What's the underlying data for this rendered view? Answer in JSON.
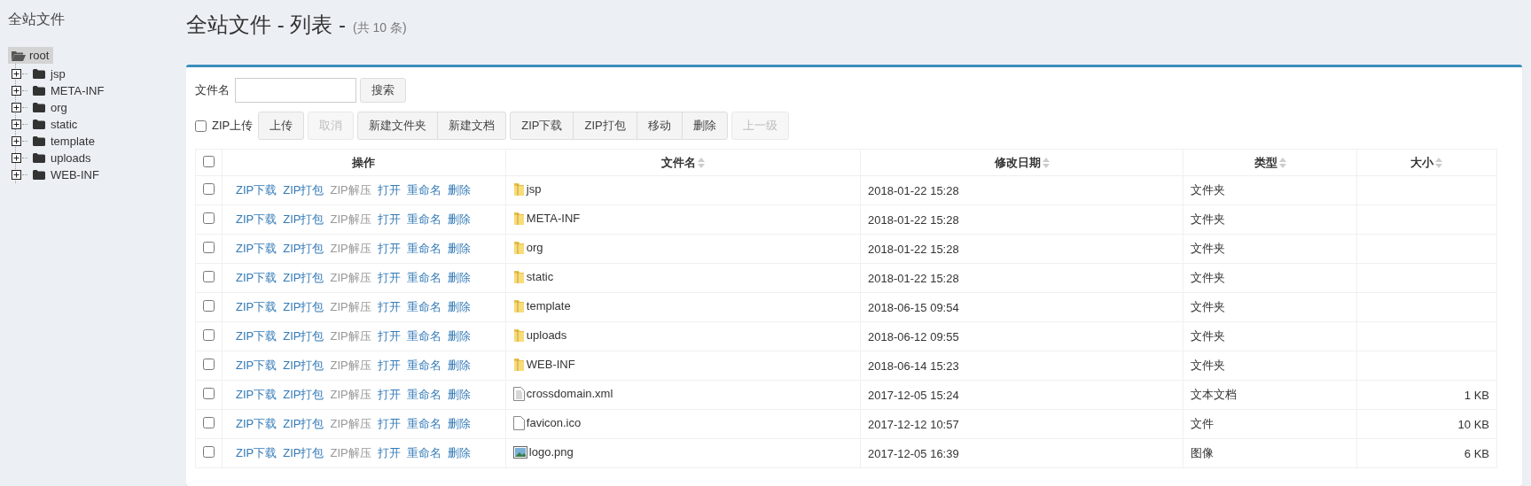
{
  "sidebar": {
    "title": "全站文件",
    "tree": {
      "label": "root",
      "selected": true,
      "expanded": true,
      "children": [
        {
          "label": "jsp",
          "selected": false,
          "expanded": false
        },
        {
          "label": "META-INF",
          "selected": false,
          "expanded": false
        },
        {
          "label": "org",
          "selected": false,
          "expanded": false
        },
        {
          "label": "static",
          "selected": false,
          "expanded": false
        },
        {
          "label": "template",
          "selected": false,
          "expanded": false
        },
        {
          "label": "uploads",
          "selected": false,
          "expanded": false
        },
        {
          "label": "WEB-INF",
          "selected": false,
          "expanded": false
        }
      ]
    }
  },
  "header": {
    "title": "全站文件 - 列表 -",
    "count": "(共 10 条)"
  },
  "search": {
    "label": "文件名",
    "button": "搜索"
  },
  "toolbar": {
    "zip_upload": {
      "label": "ZIP上传",
      "checked": false
    },
    "groups": [
      [
        {
          "label": "上传",
          "disabled": false
        }
      ],
      [
        {
          "label": "取消",
          "disabled": true
        }
      ],
      [
        {
          "label": "新建文件夹",
          "disabled": false
        },
        {
          "label": "新建文档",
          "disabled": false
        }
      ],
      [
        {
          "label": "ZIP下载",
          "disabled": false
        },
        {
          "label": "ZIP打包",
          "disabled": false
        },
        {
          "label": "移动",
          "disabled": false
        },
        {
          "label": "删除",
          "disabled": false
        }
      ],
      [
        {
          "label": "上一级",
          "disabled": true
        }
      ]
    ]
  },
  "table": {
    "select_all": {
      "checked": false
    },
    "columns": [
      {
        "label": "操作",
        "sortable": false
      },
      {
        "label": "文件名",
        "sortable": true
      },
      {
        "label": "修改日期",
        "sortable": true
      },
      {
        "label": "类型",
        "sortable": true
      },
      {
        "label": "大小",
        "sortable": true
      }
    ],
    "rows": [
      {
        "checked": false,
        "actions": [
          {
            "label": "ZIP下载",
            "disabled": false
          },
          {
            "label": "ZIP打包",
            "disabled": false
          },
          {
            "label": "ZIP解压",
            "disabled": true
          },
          {
            "label": "打开",
            "disabled": false
          },
          {
            "label": "重命名",
            "disabled": false
          },
          {
            "label": "删除",
            "disabled": false
          }
        ],
        "kind": "folder",
        "name": "jsp",
        "date": "2018-01-22 15:28",
        "type": "文件夹",
        "size": ""
      },
      {
        "checked": false,
        "actions": [
          {
            "label": "ZIP下载",
            "disabled": false
          },
          {
            "label": "ZIP打包",
            "disabled": false
          },
          {
            "label": "ZIP解压",
            "disabled": true
          },
          {
            "label": "打开",
            "disabled": false
          },
          {
            "label": "重命名",
            "disabled": false
          },
          {
            "label": "删除",
            "disabled": false
          }
        ],
        "kind": "folder",
        "name": "META-INF",
        "date": "2018-01-22 15:28",
        "type": "文件夹",
        "size": ""
      },
      {
        "checked": false,
        "actions": [
          {
            "label": "ZIP下载",
            "disabled": false
          },
          {
            "label": "ZIP打包",
            "disabled": false
          },
          {
            "label": "ZIP解压",
            "disabled": true
          },
          {
            "label": "打开",
            "disabled": false
          },
          {
            "label": "重命名",
            "disabled": false
          },
          {
            "label": "删除",
            "disabled": false
          }
        ],
        "kind": "folder",
        "name": "org",
        "date": "2018-01-22 15:28",
        "type": "文件夹",
        "size": ""
      },
      {
        "checked": false,
        "actions": [
          {
            "label": "ZIP下载",
            "disabled": false
          },
          {
            "label": "ZIP打包",
            "disabled": false
          },
          {
            "label": "ZIP解压",
            "disabled": true
          },
          {
            "label": "打开",
            "disabled": false
          },
          {
            "label": "重命名",
            "disabled": false
          },
          {
            "label": "删除",
            "disabled": false
          }
        ],
        "kind": "folder",
        "name": "static",
        "date": "2018-01-22 15:28",
        "type": "文件夹",
        "size": ""
      },
      {
        "checked": false,
        "actions": [
          {
            "label": "ZIP下载",
            "disabled": false
          },
          {
            "label": "ZIP打包",
            "disabled": false
          },
          {
            "label": "ZIP解压",
            "disabled": true
          },
          {
            "label": "打开",
            "disabled": false
          },
          {
            "label": "重命名",
            "disabled": false
          },
          {
            "label": "删除",
            "disabled": false
          }
        ],
        "kind": "folder",
        "name": "template",
        "date": "2018-06-15 09:54",
        "type": "文件夹",
        "size": ""
      },
      {
        "checked": false,
        "actions": [
          {
            "label": "ZIP下载",
            "disabled": false
          },
          {
            "label": "ZIP打包",
            "disabled": false
          },
          {
            "label": "ZIP解压",
            "disabled": true
          },
          {
            "label": "打开",
            "disabled": false
          },
          {
            "label": "重命名",
            "disabled": false
          },
          {
            "label": "删除",
            "disabled": false
          }
        ],
        "kind": "folder",
        "name": "uploads",
        "date": "2018-06-12 09:55",
        "type": "文件夹",
        "size": ""
      },
      {
        "checked": false,
        "actions": [
          {
            "label": "ZIP下载",
            "disabled": false
          },
          {
            "label": "ZIP打包",
            "disabled": false
          },
          {
            "label": "ZIP解压",
            "disabled": true
          },
          {
            "label": "打开",
            "disabled": false
          },
          {
            "label": "重命名",
            "disabled": false
          },
          {
            "label": "删除",
            "disabled": false
          }
        ],
        "kind": "folder",
        "name": "WEB-INF",
        "date": "2018-06-14 15:23",
        "type": "文件夹",
        "size": ""
      },
      {
        "checked": false,
        "actions": [
          {
            "label": "ZIP下载",
            "disabled": false
          },
          {
            "label": "ZIP打包",
            "disabled": false
          },
          {
            "label": "ZIP解压",
            "disabled": true
          },
          {
            "label": "打开",
            "disabled": false
          },
          {
            "label": "重命名",
            "disabled": false
          },
          {
            "label": "删除",
            "disabled": false
          }
        ],
        "kind": "text",
        "name": "crossdomain.xml",
        "date": "2017-12-05 15:24",
        "type": "文本文档",
        "size": "1 KB"
      },
      {
        "checked": false,
        "actions": [
          {
            "label": "ZIP下载",
            "disabled": false
          },
          {
            "label": "ZIP打包",
            "disabled": false
          },
          {
            "label": "ZIP解压",
            "disabled": true
          },
          {
            "label": "打开",
            "disabled": false
          },
          {
            "label": "重命名",
            "disabled": false
          },
          {
            "label": "删除",
            "disabled": false
          }
        ],
        "kind": "file",
        "name": "favicon.ico",
        "date": "2017-12-12 10:57",
        "type": "文件",
        "size": "10 KB"
      },
      {
        "checked": false,
        "actions": [
          {
            "label": "ZIP下载",
            "disabled": false
          },
          {
            "label": "ZIP打包",
            "disabled": false
          },
          {
            "label": "ZIP解压",
            "disabled": true
          },
          {
            "label": "打开",
            "disabled": false
          },
          {
            "label": "重命名",
            "disabled": false
          },
          {
            "label": "删除",
            "disabled": false
          }
        ],
        "kind": "image",
        "name": "logo.png",
        "date": "2017-12-05 16:39",
        "type": "图像",
        "size": "6 KB"
      }
    ]
  }
}
